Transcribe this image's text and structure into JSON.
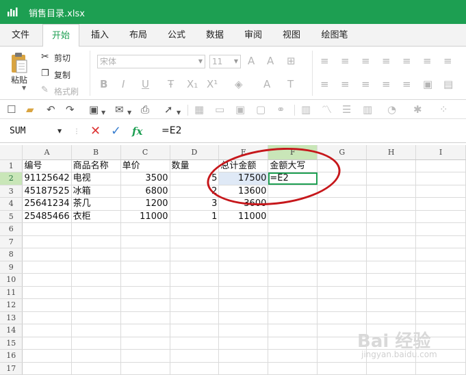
{
  "window": {
    "title": "销售目录.xlsx",
    "accent": "#1d9f52"
  },
  "menu": {
    "tabs": [
      "文件",
      "开始",
      "插入",
      "布局",
      "公式",
      "数据",
      "审阅",
      "视图",
      "绘图笔"
    ],
    "active": "开始"
  },
  "ribbon": {
    "paste": "粘贴",
    "cut": "剪切",
    "copy": "复制",
    "format_painter": "格式刷",
    "font_name": "宋体",
    "font_size": "11"
  },
  "formula_bar": {
    "name_box": "SUM",
    "cancel_icon": "✕",
    "confirm_icon": "✓",
    "fx": "fx",
    "formula": "=E2"
  },
  "sheet": {
    "columns": [
      "A",
      "B",
      "C",
      "D",
      "E",
      "F",
      "G",
      "H",
      "I"
    ],
    "rows": [
      [
        "编号",
        "商品名称",
        "单价",
        "数量",
        "总计金额",
        "金额大写",
        "",
        "",
        ""
      ],
      [
        "91125642",
        "电视",
        "3500",
        "5",
        "17500",
        "=E2",
        "",
        "",
        ""
      ],
      [
        "45187525",
        "冰箱",
        "6800",
        "2",
        "13600",
        "",
        "",
        "",
        ""
      ],
      [
        "25641234",
        "茶几",
        "1200",
        "3",
        "3600",
        "",
        "",
        "",
        ""
      ],
      [
        "25485466",
        "衣柜",
        "11000",
        "1",
        "11000",
        "",
        "",
        "",
        ""
      ],
      [
        "",
        "",
        "",
        "",
        "",
        "",
        "",
        "",
        ""
      ],
      [
        "",
        "",
        "",
        "",
        "",
        "",
        "",
        "",
        ""
      ],
      [
        "",
        "",
        "",
        "",
        "",
        "",
        "",
        "",
        ""
      ],
      [
        "",
        "",
        "",
        "",
        "",
        "",
        "",
        "",
        ""
      ],
      [
        "",
        "",
        "",
        "",
        "",
        "",
        "",
        "",
        ""
      ],
      [
        "",
        "",
        "",
        "",
        "",
        "",
        "",
        "",
        ""
      ],
      [
        "",
        "",
        "",
        "",
        "",
        "",
        "",
        "",
        ""
      ],
      [
        "",
        "",
        "",
        "",
        "",
        "",
        "",
        "",
        ""
      ],
      [
        "",
        "",
        "",
        "",
        "",
        "",
        "",
        "",
        ""
      ],
      [
        "",
        "",
        "",
        "",
        "",
        "",
        "",
        "",
        ""
      ],
      [
        "",
        "",
        "",
        "",
        "",
        "",
        "",
        "",
        ""
      ],
      [
        "",
        "",
        "",
        "",
        "",
        "",
        "",
        "",
        ""
      ]
    ],
    "numeric_columns": [
      2,
      3,
      4
    ],
    "selected_cell": "F2"
  },
  "watermark": {
    "text": "Bai 经验",
    "sub": "jingyan.baidu.com"
  }
}
